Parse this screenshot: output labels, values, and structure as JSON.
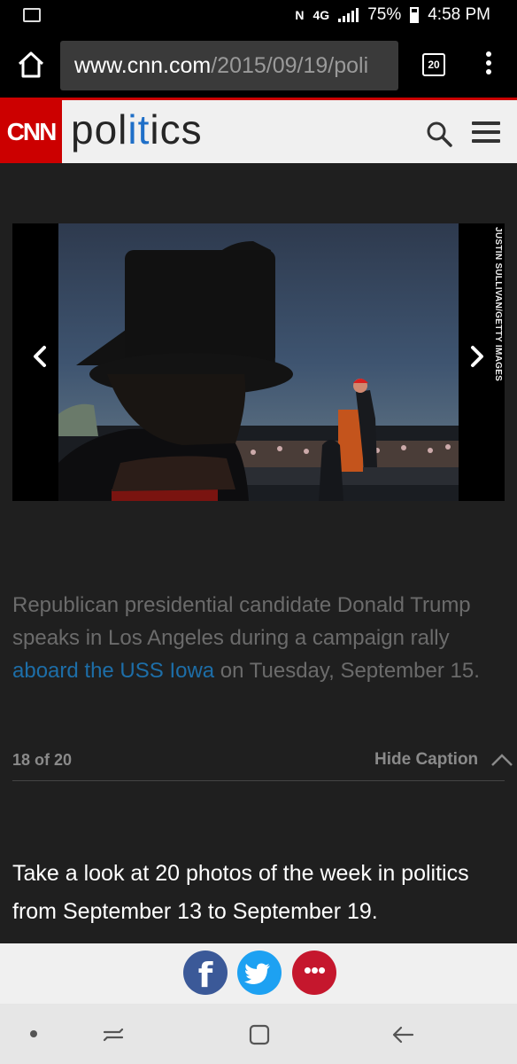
{
  "status_bar": {
    "battery": "75%",
    "time": "4:58 PM",
    "net": "4G"
  },
  "browser": {
    "url_host": "www.cnn.com",
    "url_path": "/2015/09/19/poli",
    "tab_count": "20"
  },
  "site": {
    "logo": "CNN",
    "section_a": "pol",
    "section_b": "it",
    "section_c": "ics"
  },
  "gallery": {
    "credit": "JUSTIN SULLIVAN/GETTY IMAGES",
    "caption_before": "Republican presidential candidate Donald Trump speaks in Los Angeles during a campaign rally ",
    "caption_link": "aboard the USS Iowa",
    "caption_after": " on Tuesday, September 15.",
    "counter": "18 of 20",
    "hide_caption": "Hide Caption"
  },
  "article": {
    "description": "Take a look at 20 photos of the week in politics from September 13 to September 19."
  },
  "share": {
    "facebook": "f",
    "more": "•••"
  },
  "colors": {
    "cnn_red": "#cc0000",
    "link_blue": "#1d6ea8",
    "facebook": "#3b5998",
    "twitter": "#1da1f2",
    "more": "#c5172d"
  }
}
